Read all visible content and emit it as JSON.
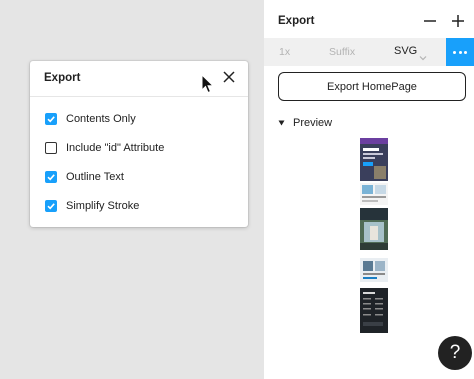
{
  "dialog": {
    "title": "Export",
    "options": [
      {
        "label": "Contents Only",
        "checked": true
      },
      {
        "label": "Include \"id\" Attribute",
        "checked": false
      },
      {
        "label": "Outline Text",
        "checked": true
      },
      {
        "label": "Simplify Stroke",
        "checked": true
      }
    ]
  },
  "panel": {
    "title": "Export",
    "settings": {
      "scale": "1x",
      "suffix_placeholder": "Suffix",
      "format": "SVG"
    },
    "export_button": "Export HomePage",
    "preview_label": "Preview"
  },
  "help": {
    "label": "?"
  },
  "colors": {
    "accent": "#18a0fb",
    "dark": "#222222",
    "canvas": "#e5e5e5",
    "panel": "#ffffff",
    "settings_bg": "#f0f0f0"
  }
}
